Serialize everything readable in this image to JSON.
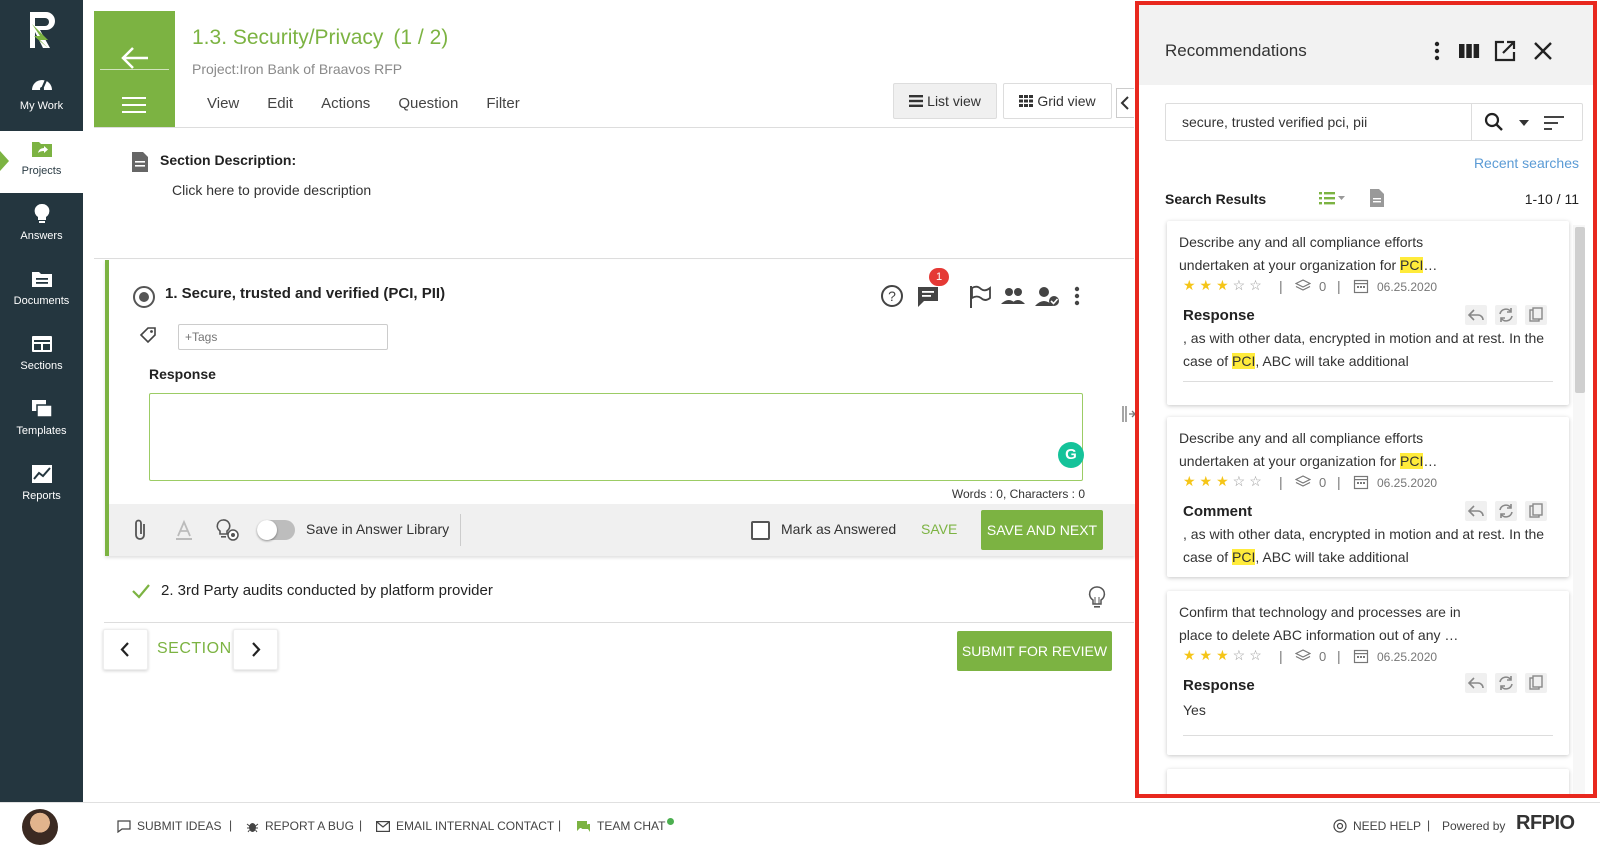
{
  "nav": {
    "items": [
      {
        "label": "My Work",
        "icon": "gauge-icon"
      },
      {
        "label": "Projects",
        "icon": "folder-share-icon",
        "active": true
      },
      {
        "label": "Answers",
        "icon": "lightbulb-icon"
      },
      {
        "label": "Documents",
        "icon": "documents-icon"
      },
      {
        "label": "Sections",
        "icon": "sections-icon"
      },
      {
        "label": "Templates",
        "icon": "templates-icon"
      },
      {
        "label": "Reports",
        "icon": "reports-icon"
      }
    ]
  },
  "header": {
    "title": "1.3. Security/Privacy",
    "count": "(1 / 2)",
    "project": "Project:Iron Bank of Braavos RFP",
    "menu": [
      "View",
      "Edit",
      "Actions",
      "Question",
      "Filter"
    ],
    "list_view": "List view",
    "grid_view": "Grid view"
  },
  "section": {
    "desc_title": "Section Description:",
    "desc_text": "Click here to provide description"
  },
  "question1": {
    "title": "1. Secure, trusted and verified (PCI, PII)",
    "comment_count": "1",
    "tags_placeholder": "+Tags",
    "response_label": "Response",
    "word_count": "Words : 0, Characters : 0",
    "save_in_library": "Save in Answer Library",
    "mark_answered": "Mark as Answered",
    "save": "SAVE",
    "save_next": "SAVE AND NEXT"
  },
  "question2": {
    "title": "2. 3rd Party audits conducted by platform provider"
  },
  "section_nav": {
    "label": "SECTION",
    "submit": "SUBMIT FOR REVIEW"
  },
  "footer": {
    "submit_ideas": "SUBMIT IDEAS",
    "report_bug": "REPORT A BUG",
    "email_contact": "EMAIL INTERNAL CONTACT",
    "team_chat": "TEAM CHAT",
    "need_help": "NEED HELP",
    "powered_by": "Powered by",
    "brand": "RFPIO"
  },
  "recommendations": {
    "title": "Recommendations",
    "search_value": "secure, trusted verified pci, pii",
    "recent_searches": "Recent searches",
    "results_label": "Search Results",
    "results_count": "1-10 / 11",
    "cards": [
      {
        "q_before": "Describe any and all compliance efforts undertaken at your organization for ",
        "q_hl": "PCI",
        "q_after": "…",
        "rating": 3,
        "versions": "0",
        "date": "06.25.2020",
        "resp_head": "Response",
        "r_before": ", as with other data, encrypted in motion and at rest. In the case of ",
        "r_hl": "PCI",
        "r_after": ", ABC will take additional"
      },
      {
        "q_before": "Describe any and all compliance efforts undertaken at your organization for ",
        "q_hl": "PCI",
        "q_after": "…",
        "rating": 3,
        "versions": "0",
        "date": "06.25.2020",
        "resp_head": "Comment",
        "r_before": ", as with other data, encrypted in motion and at rest. In the case of ",
        "r_hl": "PCI",
        "r_after": ", ABC will take additional"
      },
      {
        "q_before": "Confirm that technology and processes are in place to delete ABC information out of any …",
        "q_hl": "",
        "q_after": "",
        "rating": 3,
        "versions": "0",
        "date": "06.25.2020",
        "resp_head": "Response",
        "r_before": "Yes",
        "r_hl": "",
        "r_after": ""
      }
    ]
  },
  "colors": {
    "brand_green": "#7cb342",
    "nav_bg": "#24363f",
    "highlight": "#ffeb3b",
    "panel_border": "#e8281e",
    "badge_red": "#e53935"
  }
}
